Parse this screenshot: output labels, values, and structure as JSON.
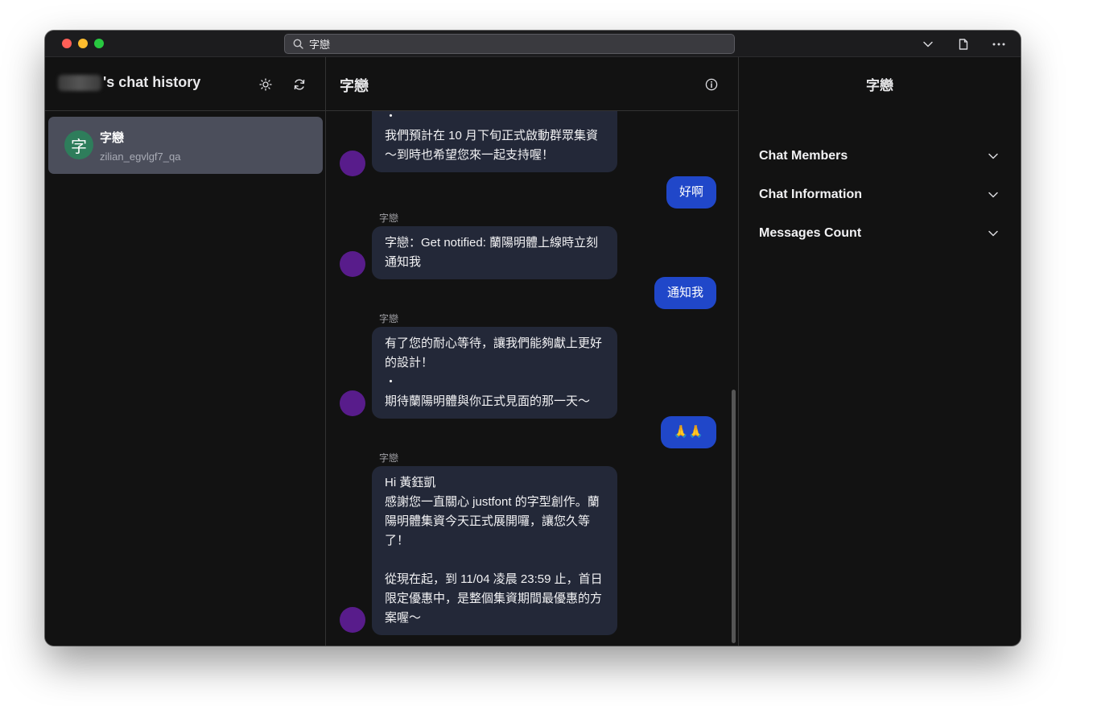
{
  "titlebar": {
    "search_value": "字戀"
  },
  "sidebar": {
    "title_suffix": "'s chat history",
    "chats": [
      {
        "avatar_char": "字",
        "name": "字戀",
        "username": "zilian_egvlgf7_qa"
      }
    ]
  },
  "conversation": {
    "title": "字戀",
    "messages": [
      {
        "dir": "in",
        "sender": "",
        "text": "・\n我們預計在 10 月下旬正式啟動群眾集資～到時也希望您來一起支持喔！"
      },
      {
        "dir": "out",
        "text": "好啊"
      },
      {
        "dir": "in",
        "sender": "字戀",
        "text": "字戀：Get notified: 蘭陽明體上線時立刻通知我"
      },
      {
        "dir": "out",
        "text": "通知我"
      },
      {
        "dir": "in",
        "sender": "字戀",
        "text": "有了您的耐心等待，讓我們能夠獻上更好的設計！\n・\n期待蘭陽明體與你正式見面的那一天～"
      },
      {
        "dir": "out",
        "text": "🙏🙏"
      },
      {
        "dir": "in",
        "sender": "字戀",
        "text": "Hi 黃鈺凱\n感謝您一直關心 justfont 的字型創作。蘭陽明體集資今天正式展開囉，讓您久等了！\n\n從現在起，到 11/04 凌晨 23:59 止，首日限定優惠中，是整個集資期間最優惠的方案喔～"
      }
    ]
  },
  "details": {
    "title": "字戀",
    "sections": [
      {
        "label": "Chat Members"
      },
      {
        "label": "Chat Information"
      },
      {
        "label": "Messages Count"
      }
    ]
  },
  "colors": {
    "outgoing_bubble": "#2047c9",
    "incoming_bubble": "#232838",
    "avatar_purple": "#581c8b",
    "avatar_green": "#2e7d5b",
    "selected_chat": "#4b4e5b"
  }
}
